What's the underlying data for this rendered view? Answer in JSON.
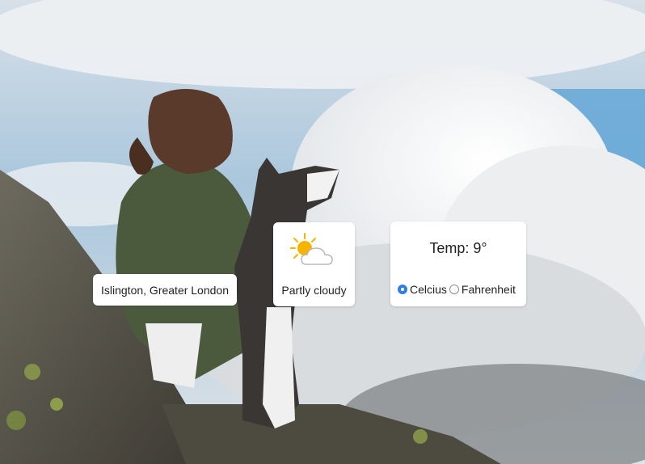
{
  "location": {
    "text": "Islington, Greater London"
  },
  "condition": {
    "label": "Partly cloudy",
    "icon": "partly-cloudy-icon"
  },
  "temperature": {
    "text": "Temp: 9°"
  },
  "units": {
    "options": [
      {
        "label": "Celcius",
        "checked": true
      },
      {
        "label": "Fahrenheit",
        "checked": false
      }
    ]
  },
  "colors": {
    "accent": "#2f7ee8",
    "sun": "#f5b400"
  }
}
